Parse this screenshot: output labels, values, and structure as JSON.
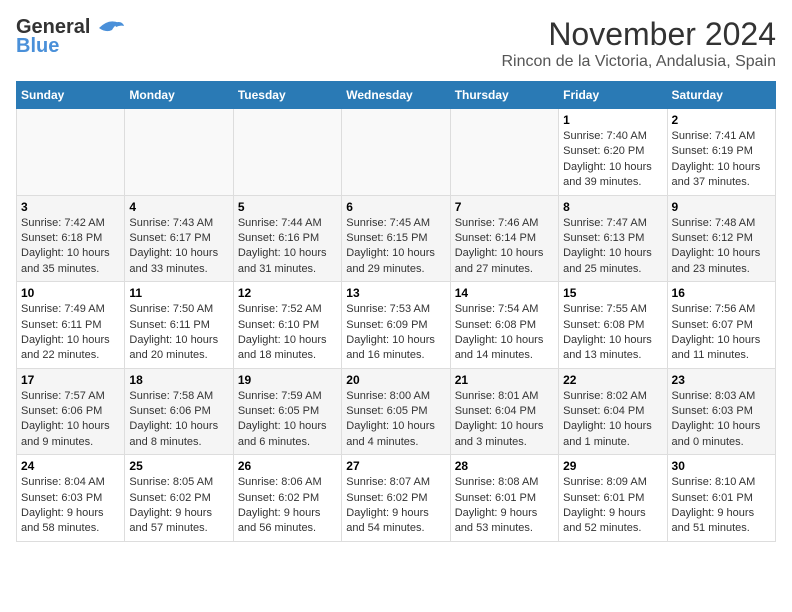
{
  "logo": {
    "general": "General",
    "blue": "Blue"
  },
  "title": "November 2024",
  "subtitle": "Rincon de la Victoria, Andalusia, Spain",
  "days_of_week": [
    "Sunday",
    "Monday",
    "Tuesday",
    "Wednesday",
    "Thursday",
    "Friday",
    "Saturday"
  ],
  "weeks": [
    [
      {
        "day": "",
        "info": ""
      },
      {
        "day": "",
        "info": ""
      },
      {
        "day": "",
        "info": ""
      },
      {
        "day": "",
        "info": ""
      },
      {
        "day": "",
        "info": ""
      },
      {
        "day": "1",
        "info": "Sunrise: 7:40 AM\nSunset: 6:20 PM\nDaylight: 10 hours and 39 minutes."
      },
      {
        "day": "2",
        "info": "Sunrise: 7:41 AM\nSunset: 6:19 PM\nDaylight: 10 hours and 37 minutes."
      }
    ],
    [
      {
        "day": "3",
        "info": "Sunrise: 7:42 AM\nSunset: 6:18 PM\nDaylight: 10 hours and 35 minutes."
      },
      {
        "day": "4",
        "info": "Sunrise: 7:43 AM\nSunset: 6:17 PM\nDaylight: 10 hours and 33 minutes."
      },
      {
        "day": "5",
        "info": "Sunrise: 7:44 AM\nSunset: 6:16 PM\nDaylight: 10 hours and 31 minutes."
      },
      {
        "day": "6",
        "info": "Sunrise: 7:45 AM\nSunset: 6:15 PM\nDaylight: 10 hours and 29 minutes."
      },
      {
        "day": "7",
        "info": "Sunrise: 7:46 AM\nSunset: 6:14 PM\nDaylight: 10 hours and 27 minutes."
      },
      {
        "day": "8",
        "info": "Sunrise: 7:47 AM\nSunset: 6:13 PM\nDaylight: 10 hours and 25 minutes."
      },
      {
        "day": "9",
        "info": "Sunrise: 7:48 AM\nSunset: 6:12 PM\nDaylight: 10 hours and 23 minutes."
      }
    ],
    [
      {
        "day": "10",
        "info": "Sunrise: 7:49 AM\nSunset: 6:11 PM\nDaylight: 10 hours and 22 minutes."
      },
      {
        "day": "11",
        "info": "Sunrise: 7:50 AM\nSunset: 6:11 PM\nDaylight: 10 hours and 20 minutes."
      },
      {
        "day": "12",
        "info": "Sunrise: 7:52 AM\nSunset: 6:10 PM\nDaylight: 10 hours and 18 minutes."
      },
      {
        "day": "13",
        "info": "Sunrise: 7:53 AM\nSunset: 6:09 PM\nDaylight: 10 hours and 16 minutes."
      },
      {
        "day": "14",
        "info": "Sunrise: 7:54 AM\nSunset: 6:08 PM\nDaylight: 10 hours and 14 minutes."
      },
      {
        "day": "15",
        "info": "Sunrise: 7:55 AM\nSunset: 6:08 PM\nDaylight: 10 hours and 13 minutes."
      },
      {
        "day": "16",
        "info": "Sunrise: 7:56 AM\nSunset: 6:07 PM\nDaylight: 10 hours and 11 minutes."
      }
    ],
    [
      {
        "day": "17",
        "info": "Sunrise: 7:57 AM\nSunset: 6:06 PM\nDaylight: 10 hours and 9 minutes."
      },
      {
        "day": "18",
        "info": "Sunrise: 7:58 AM\nSunset: 6:06 PM\nDaylight: 10 hours and 8 minutes."
      },
      {
        "day": "19",
        "info": "Sunrise: 7:59 AM\nSunset: 6:05 PM\nDaylight: 10 hours and 6 minutes."
      },
      {
        "day": "20",
        "info": "Sunrise: 8:00 AM\nSunset: 6:05 PM\nDaylight: 10 hours and 4 minutes."
      },
      {
        "day": "21",
        "info": "Sunrise: 8:01 AM\nSunset: 6:04 PM\nDaylight: 10 hours and 3 minutes."
      },
      {
        "day": "22",
        "info": "Sunrise: 8:02 AM\nSunset: 6:04 PM\nDaylight: 10 hours and 1 minute."
      },
      {
        "day": "23",
        "info": "Sunrise: 8:03 AM\nSunset: 6:03 PM\nDaylight: 10 hours and 0 minutes."
      }
    ],
    [
      {
        "day": "24",
        "info": "Sunrise: 8:04 AM\nSunset: 6:03 PM\nDaylight: 9 hours and 58 minutes."
      },
      {
        "day": "25",
        "info": "Sunrise: 8:05 AM\nSunset: 6:02 PM\nDaylight: 9 hours and 57 minutes."
      },
      {
        "day": "26",
        "info": "Sunrise: 8:06 AM\nSunset: 6:02 PM\nDaylight: 9 hours and 56 minutes."
      },
      {
        "day": "27",
        "info": "Sunrise: 8:07 AM\nSunset: 6:02 PM\nDaylight: 9 hours and 54 minutes."
      },
      {
        "day": "28",
        "info": "Sunrise: 8:08 AM\nSunset: 6:01 PM\nDaylight: 9 hours and 53 minutes."
      },
      {
        "day": "29",
        "info": "Sunrise: 8:09 AM\nSunset: 6:01 PM\nDaylight: 9 hours and 52 minutes."
      },
      {
        "day": "30",
        "info": "Sunrise: 8:10 AM\nSunset: 6:01 PM\nDaylight: 9 hours and 51 minutes."
      }
    ]
  ]
}
